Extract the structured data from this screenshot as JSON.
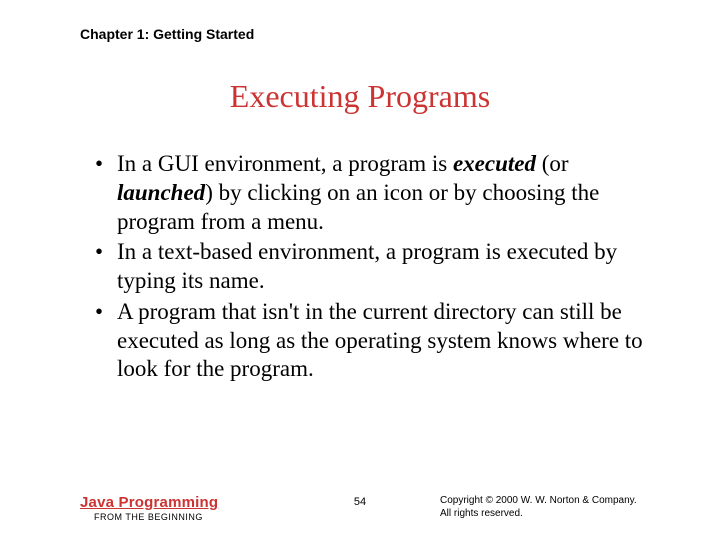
{
  "header": {
    "chapter": "Chapter 1: Getting Started"
  },
  "title": "Executing Programs",
  "bullets": [
    {
      "pre": "In a GUI environment, a program is ",
      "em1": "executed",
      "mid": " (or ",
      "em2": "launched",
      "post": ") by clicking on an icon or by choosing the program from a menu."
    },
    {
      "pre": "In a text-based environment, a program is executed by typing its name.",
      "em1": "",
      "mid": "",
      "em2": "",
      "post": ""
    },
    {
      "pre": "A program that isn't in the current directory can still be executed as long as the operating system knows where to look for the program.",
      "em1": "",
      "mid": "",
      "em2": "",
      "post": ""
    }
  ],
  "footer": {
    "book_title": "Java Programming",
    "book_sub": "FROM THE BEGINNING",
    "page": "54",
    "copyright_line1": "Copyright © 2000 W. W. Norton & Company.",
    "copyright_line2": "All rights reserved."
  }
}
